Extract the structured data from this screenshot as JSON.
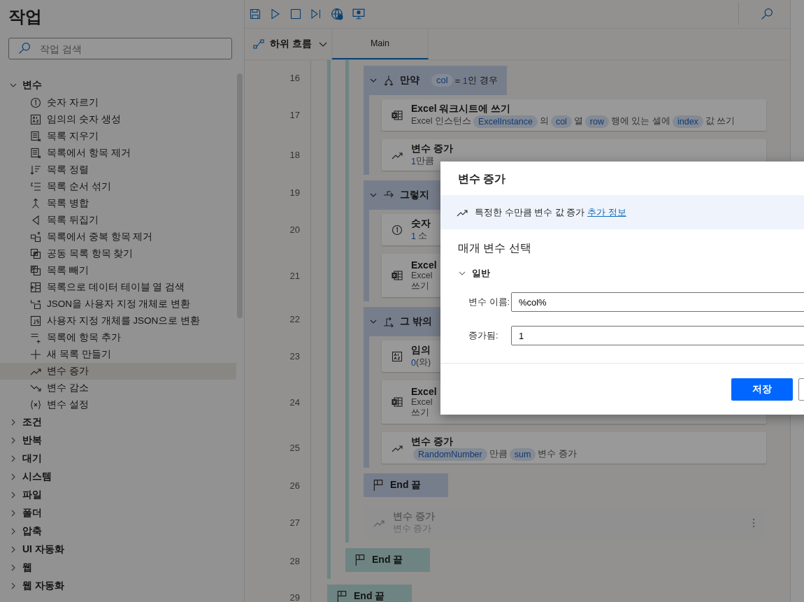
{
  "sidebar": {
    "title": "작업",
    "search": {
      "placeholder": "작업 검색"
    },
    "groups": [
      {
        "label": "변수",
        "expanded": true,
        "children": [
          {
            "label": "숫자 자르기",
            "kind": "truncate",
            "selected": false
          },
          {
            "label": "임의의 숫자 생성",
            "kind": "random",
            "selected": false
          },
          {
            "label": "목록 지우기",
            "kind": "clear",
            "selected": false
          },
          {
            "label": "목록에서 항목 제거",
            "kind": "remove",
            "selected": false
          },
          {
            "label": "목록 정렬",
            "kind": "sort",
            "selected": false
          },
          {
            "label": "목록 순서 섞기",
            "kind": "shuffle",
            "selected": false
          },
          {
            "label": "목록 병합",
            "kind": "merge",
            "selected": false
          },
          {
            "label": "목록 뒤집기",
            "kind": "reverse",
            "selected": false
          },
          {
            "label": "목록에서 중복 항목 제거",
            "kind": "dedupe",
            "selected": false
          },
          {
            "label": "공동 목록 항목 찾기",
            "kind": "intersect",
            "selected": false
          },
          {
            "label": "목록 빼기",
            "kind": "subtract",
            "selected": false
          },
          {
            "label": "목록으로 데이터 테이블 열 검색",
            "kind": "retrieve",
            "selected": false
          },
          {
            "label": "JSON을 사용자 지정 개체로 변환",
            "kind": "to_object",
            "selected": false
          },
          {
            "label": "사용자 지정 개체를 JSON으로 변환",
            "kind": "to_json",
            "selected": false
          },
          {
            "label": "목록에 항목 추가",
            "kind": "add",
            "selected": false
          },
          {
            "label": "새 목록 만들기",
            "kind": "create",
            "selected": false
          },
          {
            "label": "변수 증가",
            "kind": "increase",
            "selected": true
          },
          {
            "label": "변수 감소",
            "kind": "decrease",
            "selected": false
          },
          {
            "label": "변수 설정",
            "kind": "set",
            "selected": false
          }
        ]
      },
      {
        "label": "조건",
        "expanded": false
      },
      {
        "label": "반복",
        "expanded": false
      },
      {
        "label": "대기",
        "expanded": false
      },
      {
        "label": "시스템",
        "expanded": false
      },
      {
        "label": "파일",
        "expanded": false
      },
      {
        "label": "폴더",
        "expanded": false
      },
      {
        "label": "압축",
        "expanded": false
      },
      {
        "label": "UI 자동화",
        "expanded": false
      },
      {
        "label": "웹",
        "expanded": false
      },
      {
        "label": "웹 자동화",
        "expanded": false
      }
    ]
  },
  "subflows": {
    "label": "하위 흐름",
    "tabs": [
      {
        "label": "Main",
        "selected": true
      }
    ]
  },
  "flow": [
    {
      "kind": "loop",
      "children": [
        {
          "kind": "loop",
          "children": [
            {
              "kind": "if",
              "line": "16",
              "title": "만약",
              "expanded": true,
              "parts": [
                {
                  "kind": "var",
                  "text": "col"
                },
                {
                  "kind": "text",
                  "text": "= "
                },
                {
                  "kind": "num",
                  "text": "1"
                },
                {
                  "kind": "text",
                  "text": "인 경우"
                }
              ],
              "children": [
                {
                  "kind": "excel_write",
                  "line": "17",
                  "title": "Excel 워크시트에 쓰기",
                  "disabled": false,
                  "lines": [
                    [
                      {
                        "kind": "text",
                        "text": "Excel 인스턴스"
                      },
                      {
                        "kind": "var",
                        "text": "ExcelInstance"
                      },
                      {
                        "kind": "text",
                        "text": "의"
                      },
                      {
                        "kind": "var",
                        "text": "col"
                      },
                      {
                        "kind": "text",
                        "text": "열"
                      },
                      {
                        "kind": "var",
                        "text": "row"
                      },
                      {
                        "kind": "text",
                        "text": "행에 있는 셀에"
                      },
                      {
                        "kind": "var",
                        "text": "index"
                      },
                      {
                        "kind": "text",
                        "text": "값 쓰기"
                      }
                    ]
                  ]
                },
                {
                  "kind": "increment",
                  "line": "18",
                  "title": "변수 증가",
                  "disabled": false,
                  "lines": [
                    [
                      {
                        "kind": "num",
                        "text": "1"
                      },
                      {
                        "kind": "text",
                        "text": "만큼"
                      }
                    ]
                  ]
                }
              ]
            },
            {
              "kind": "else_if",
              "line": "19",
              "title": "그렇지",
              "expanded": true,
              "children": [
                {
                  "kind": "truncate",
                  "line": "20",
                  "title": "숫자",
                  "disabled": false,
                  "lines": [
                    [
                      {
                        "kind": "num",
                        "text": "1"
                      },
                      {
                        "kind": "text",
                        "text": " 소"
                      }
                    ]
                  ]
                },
                {
                  "kind": "excel_write",
                  "line": "21",
                  "title": "Excel",
                  "disabled": false,
                  "lines": [
                    [
                      {
                        "kind": "text",
                        "text": "Excel"
                      }
                    ],
                    [
                      {
                        "kind": "text",
                        "text": "쓰기"
                      }
                    ]
                  ]
                }
              ]
            },
            {
              "kind": "else",
              "line": "22",
              "title": "그 밖의",
              "expanded": true,
              "children": [
                {
                  "kind": "random",
                  "line": "23",
                  "title": "임의",
                  "disabled": false,
                  "lines": [
                    [
                      {
                        "kind": "num",
                        "text": "0"
                      },
                      {
                        "kind": "text",
                        "text": "(와)"
                      }
                    ]
                  ]
                },
                {
                  "kind": "excel_write",
                  "line": "24",
                  "title": "Excel",
                  "disabled": false,
                  "lines": [
                    [
                      {
                        "kind": "text",
                        "text": "Excel"
                      }
                    ],
                    [
                      {
                        "kind": "text",
                        "text": "쓰기"
                      }
                    ]
                  ]
                },
                {
                  "kind": "increment",
                  "line": "25",
                  "title": "변수 증가",
                  "disabled": false,
                  "lines": [
                    [
                      {
                        "kind": "var",
                        "text": "RandomNumber"
                      },
                      {
                        "kind": "text",
                        "text": "만큼"
                      },
                      {
                        "kind": "var",
                        "text": "sum"
                      },
                      {
                        "kind": "text",
                        "text": "변수 증가"
                      }
                    ]
                  ]
                }
              ]
            },
            {
              "kind": "end_if",
              "line": "26",
              "label": "End 끝"
            },
            {
              "kind": "increment",
              "line": "27",
              "title": "변수 증가",
              "disabled": true,
              "lines": [
                [
                  {
                    "kind": "text",
                    "text": "변수 증가"
                  }
                ]
              ]
            }
          ],
          "end": {
            "line": "28",
            "label": "End 끝"
          }
        }
      ],
      "end": {
        "line": "29",
        "label": "End 끝"
      }
    }
  ],
  "dialog": {
    "title": "변수 증가",
    "info": {
      "text": "특정한 수만큼 변수 값 증가",
      "link": "추가 정보"
    },
    "section": "매개 변수 선택",
    "group": {
      "label": "일반",
      "expanded": true
    },
    "fields": [
      {
        "label": "변수 이름:",
        "value": "%col%"
      },
      {
        "label": "증가됨:",
        "value": "1"
      }
    ],
    "buttons": [
      {
        "kind": "primary",
        "label": "저장"
      },
      {
        "kind": "secondary"
      }
    ]
  }
}
